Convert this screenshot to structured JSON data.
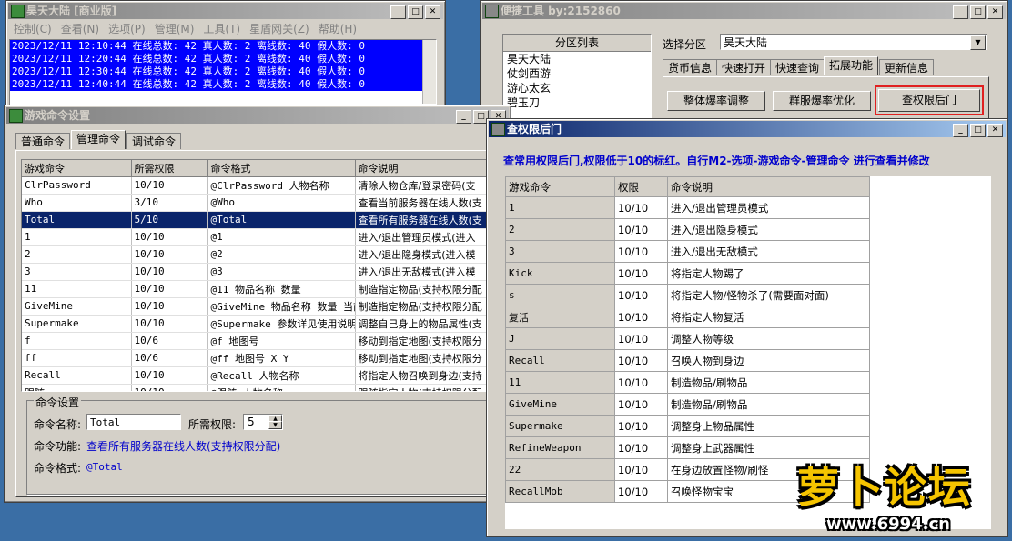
{
  "main_window": {
    "title": "昊天大陆 [商业版]",
    "menu": [
      "控制(C)",
      "查看(N)",
      "选项(P)",
      "管理(M)",
      "工具(T)",
      "星盾网关(Z)",
      "帮助(H)"
    ],
    "logs": [
      "2023/12/11 12:10:44 在线总数: 42 真人数: 2 离线数: 40 假人数: 0",
      "2023/12/11 12:20:44 在线总数: 42 真人数: 2 离线数: 40 假人数: 0",
      "2023/12/11 12:30:44 在线总数: 42 真人数: 2 离线数: 40 假人数: 0",
      "2023/12/11 12:40:44 在线总数: 42 真人数: 2 离线数: 40 假人数: 0"
    ]
  },
  "quick_tools": {
    "title": "便捷工具    by:2152860",
    "zone_list_header": "分区列表",
    "zones": [
      "昊天大陆",
      "仗剑西游",
      "游心太玄",
      "碧玉刀"
    ],
    "select_zone_label": "选择分区",
    "selected_zone": "昊天大陆",
    "tabs": [
      "货币信息",
      "快速打开",
      "快速查询",
      "拓展功能",
      "更新信息"
    ],
    "buttons": [
      "整体爆率调整",
      "群服爆率优化",
      "查权限后门"
    ]
  },
  "cmd_settings": {
    "title": "游戏命令设置",
    "tabs": [
      "普通命令",
      "管理命令",
      "调试命令"
    ],
    "columns": [
      "游戏命令",
      "所需权限",
      "命令格式",
      "命令说明"
    ],
    "rows": [
      [
        "ClrPassword",
        "10/10",
        "@ClrPassword 人物名称",
        "清除人物仓库/登录密码(支"
      ],
      [
        "Who",
        "3/10",
        "@Who",
        "查看当前服务器在线人数(支"
      ],
      [
        "Total",
        "5/10",
        "@Total",
        "查看所有服务器在线人数(支"
      ],
      [
        "1",
        "10/10",
        "@1",
        "进入/退出管理员模式(进入"
      ],
      [
        "2",
        "10/10",
        "@2",
        "进入/退出隐身模式(进入模"
      ],
      [
        "3",
        "10/10",
        "@3",
        "进入/退出无敌模式(进入模"
      ],
      [
        "11",
        "10/10",
        "@11 物品名称 数量",
        "制造指定物品(支持权限分配"
      ],
      [
        "GiveMine",
        "10/10",
        "@GiveMine 物品名称 数量 当前",
        "制造指定物品(支持权限分配"
      ],
      [
        "Supermake",
        "10/10",
        "@Supermake 参数详见使用说明",
        "调整自己身上的物品属性(支"
      ],
      [
        "f",
        "10/6",
        "@f 地图号",
        "移动到指定地图(支持权限分"
      ],
      [
        "ff",
        "10/6",
        "@ff 地图号 X Y",
        "移动到指定地图(支持权限分"
      ],
      [
        "Recall",
        "10/10",
        "@Recall 人物名称",
        "将指定人物召唤到身边(支持"
      ],
      [
        "跟随",
        "10/10",
        "@跟随 人物名称",
        "跟随指定人物(支持权限分配"
      ]
    ],
    "group_label": "命令设置",
    "name_label": "命令名称:",
    "name_value": "Total",
    "perm_label": "所需权限:",
    "perm_value": "5",
    "func_label": "命令功能:",
    "func_value": "查看所有服务器在线人数(支持权限分配)",
    "format_label": "命令格式:",
    "format_value": "@Total"
  },
  "perm_window": {
    "title": "查权限后门",
    "notice": "查常用权限后门,权限低于10的标红。自行M2-选项-游戏命令-管理命令 进行查看并修改",
    "columns": [
      "游戏命令",
      "权限",
      "命令说明"
    ],
    "rows": [
      [
        "1",
        "10/10",
        "进入/退出管理员模式"
      ],
      [
        "2",
        "10/10",
        "进入/退出隐身模式"
      ],
      [
        "3",
        "10/10",
        "进入/退出无敌模式"
      ],
      [
        "Kick",
        "10/10",
        "将指定人物踢了"
      ],
      [
        "s",
        "10/10",
        "将指定人物/怪物杀了(需要面对面)"
      ],
      [
        "复活",
        "10/10",
        "将指定人物复活"
      ],
      [
        "J",
        "10/10",
        "调整人物等级"
      ],
      [
        "Recall",
        "10/10",
        "召唤人物到身边"
      ],
      [
        "11",
        "10/10",
        "制造物品/刷物品"
      ],
      [
        "GiveMine",
        "10/10",
        "制造物品/刷物品"
      ],
      [
        "Supermake",
        "10/10",
        "调整身上物品属性"
      ],
      [
        "RefineWeapon",
        "10/10",
        "调整身上武器属性"
      ],
      [
        "22",
        "10/10",
        "在身边放置怪物/刷怪"
      ],
      [
        "RecallMob",
        "10/10",
        "召唤怪物宝宝"
      ]
    ]
  },
  "watermark": {
    "text": "萝卜论坛",
    "url": "www.6994.cn"
  },
  "colors": {
    "log_bg": "#0000ff",
    "selection": "#0a246a",
    "notice": "#0000cc",
    "watermark": "#f5c400"
  }
}
